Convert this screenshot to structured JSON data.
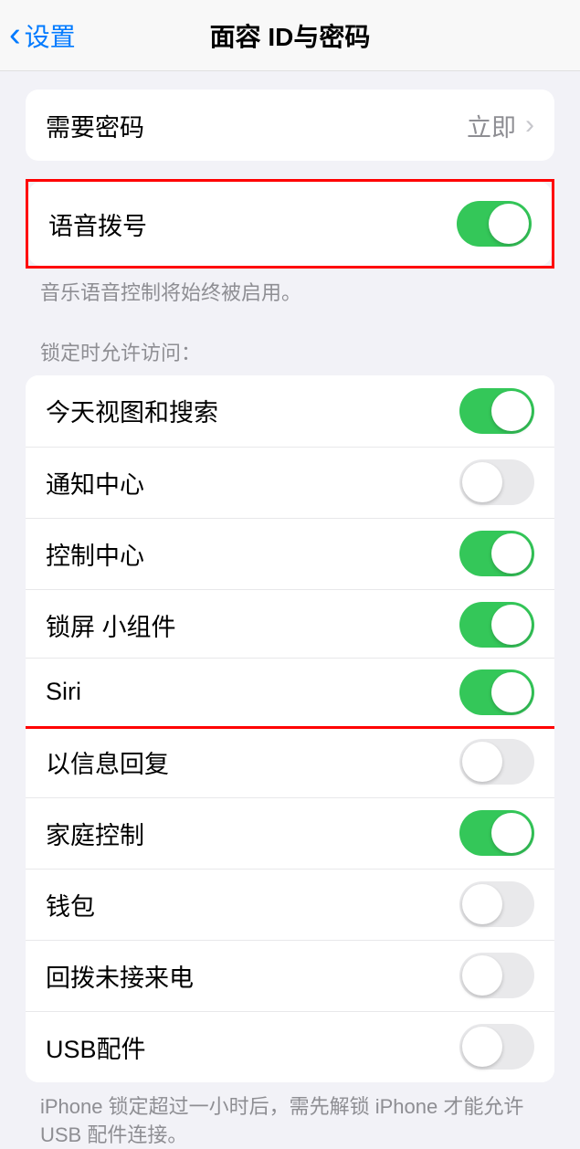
{
  "header": {
    "back_label": "设置",
    "title": "面容 ID与密码"
  },
  "passcode_row": {
    "label": "需要密码",
    "value": "立即"
  },
  "voice_dial": {
    "label": "语音拨号",
    "on": true,
    "footer": "音乐语音控制将始终被启用。"
  },
  "lock_section": {
    "header": "锁定时允许访问：",
    "items": [
      {
        "label": "今天视图和搜索",
        "on": true
      },
      {
        "label": "通知中心",
        "on": false
      },
      {
        "label": "控制中心",
        "on": true
      },
      {
        "label": "锁屏 小组件",
        "on": true
      },
      {
        "label": "Siri",
        "on": true
      },
      {
        "label": "以信息回复",
        "on": false
      },
      {
        "label": "家庭控制",
        "on": true
      },
      {
        "label": "钱包",
        "on": false
      },
      {
        "label": "回拨未接来电",
        "on": false
      },
      {
        "label": "USB配件",
        "on": false
      }
    ],
    "footer": "iPhone 锁定超过一小时后，需先解锁 iPhone 才能允许 USB 配件连接。"
  }
}
